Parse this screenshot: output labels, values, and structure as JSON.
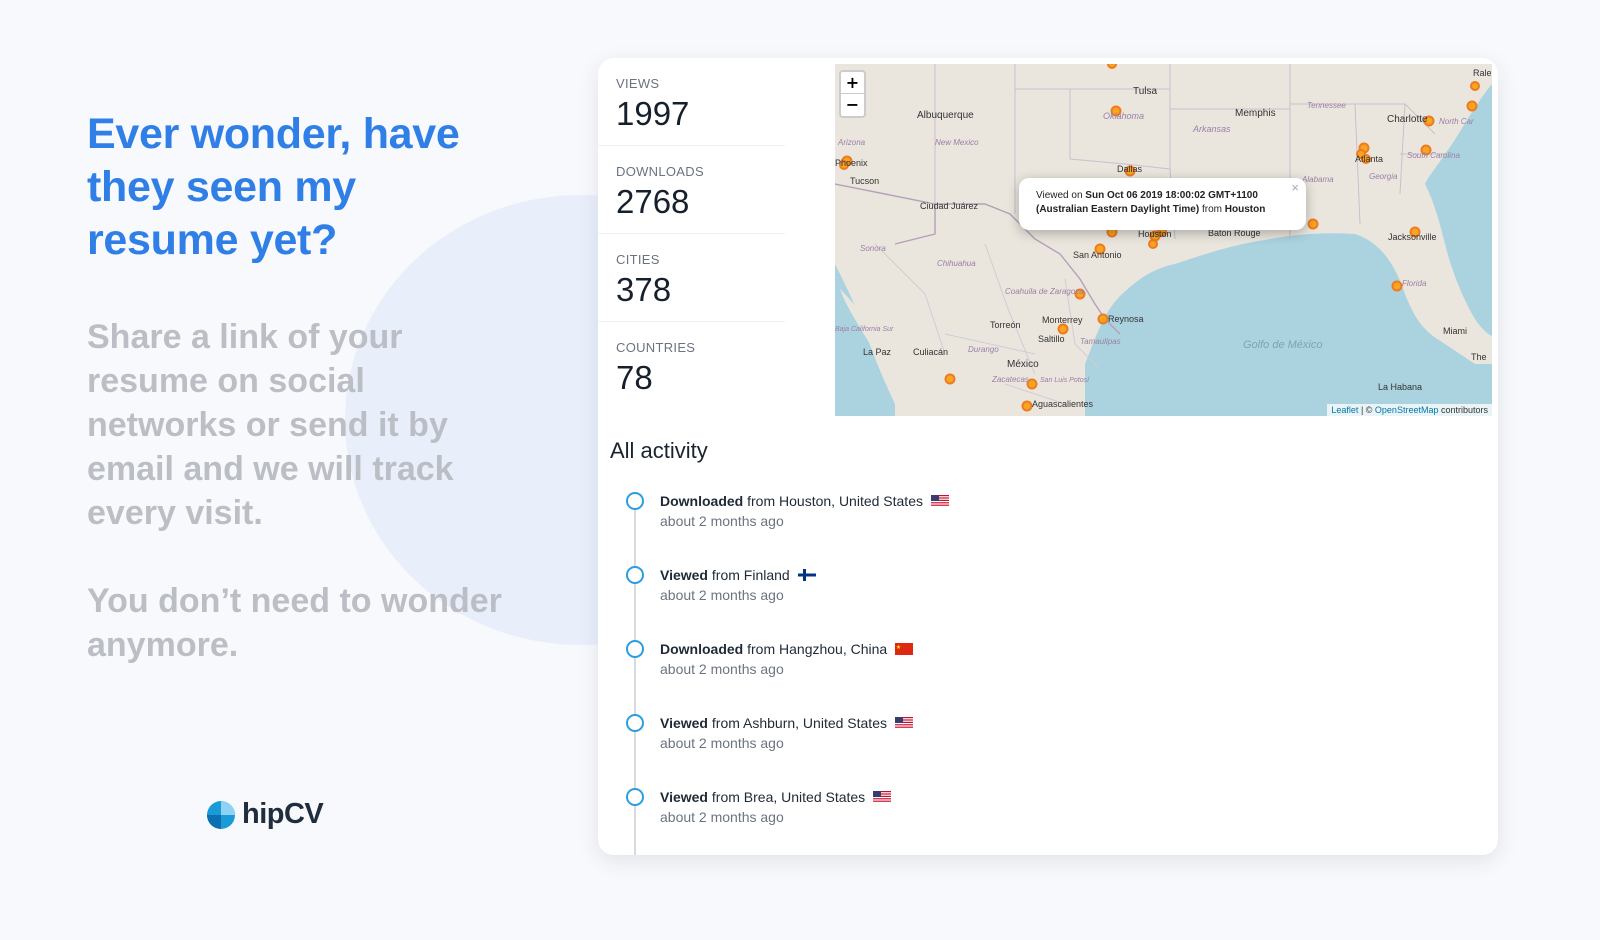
{
  "hero": {
    "title": "Ever wonder, have they seen my resume yet?",
    "body": "Share a link of your resume on social networks or send it by email and we will track every visit.",
    "body2": "You don’t need to wonder anymore."
  },
  "brand": {
    "name": "hipCV",
    "accent": "#2f7fe6"
  },
  "stats": [
    {
      "label": "VIEWS",
      "value": "1997"
    },
    {
      "label": "DOWNLOADS",
      "value": "2768"
    },
    {
      "label": "CITIES",
      "value": "378"
    },
    {
      "label": "COUNTRIES",
      "value": "78"
    }
  ],
  "map": {
    "zoom_in": "+",
    "zoom_out": "−",
    "popup": {
      "prefix": "Viewed on ",
      "date": "Sun Oct 06 2019 18:00:02 GMT+1100 (Australian Eastern Daylight Time)",
      "middle": " from ",
      "city": "Houston",
      "close": "×"
    },
    "attribution": {
      "leaflet": "Leaflet",
      "sep": " | © ",
      "osm": "OpenStreetMap",
      "suffix": " contributors"
    },
    "labels": [
      "Tulsa",
      "Memphis",
      "Albuquerque",
      "Oklahoma",
      "Arkansas",
      "Tennessee",
      "Charlotte",
      "North Car",
      "Ralei",
      "New Mexico",
      "Arizona",
      "Atlanta",
      "South Carolina",
      "Tucson",
      "Dallas",
      "Alabama",
      "Georgia",
      "Ciudad Juárez",
      "Houston",
      "Baton Rouge",
      "Jacksonville",
      "Sonora",
      "San Antonio",
      "Chihuahua",
      "Coahuila de Zaragoza",
      "Florida",
      "Torreón",
      "Monterrey",
      "Reynosa",
      "Saltillo",
      "Tamaulipas",
      "Miami",
      "Golfo de México",
      "Culiacán",
      "La Paz",
      "Durango",
      "México",
      "Zacatecas",
      "San Luis Potosí",
      "Aguascalientes",
      "La Habana",
      "The",
      "Baja California Sur",
      "Phoenix"
    ]
  },
  "activity": {
    "title": "All activity",
    "items": [
      {
        "action": "Downloaded",
        "location": " from Houston, United States",
        "time": "about 2 months ago",
        "flag": "us"
      },
      {
        "action": "Viewed",
        "location": " from Finland",
        "time": "about 2 months ago",
        "flag": "fi"
      },
      {
        "action": "Downloaded",
        "location": " from Hangzhou, China",
        "time": "about 2 months ago",
        "flag": "cn"
      },
      {
        "action": "Viewed",
        "location": " from Ashburn, United States",
        "time": "about 2 months ago",
        "flag": "us"
      },
      {
        "action": "Viewed",
        "location": " from Brea, United States",
        "time": "about 2 months ago",
        "flag": "us"
      }
    ]
  }
}
